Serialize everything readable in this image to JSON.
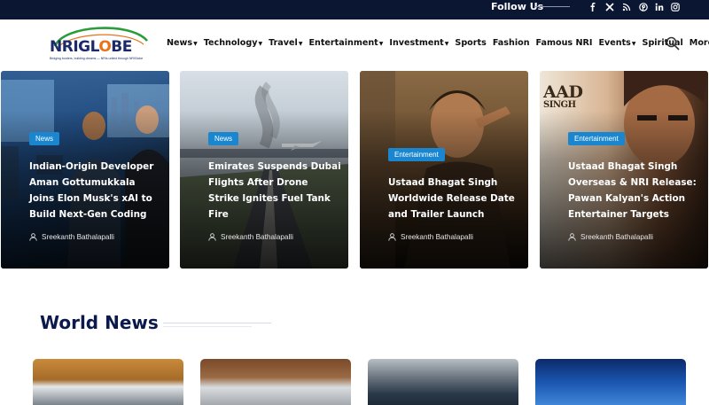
{
  "topbar": {
    "follow_label": "Follow Us",
    "social_icons": [
      "facebook-icon",
      "x-icon",
      "rss-icon",
      "pinterest-icon",
      "linkedin-icon",
      "instagram-icon"
    ]
  },
  "brand": {
    "name_part1": "NRI",
    "name_part2": "GL",
    "name_o": "O",
    "name_part3": "BE",
    "tagline": "Bridging borders, building dreams — NRIs united through NRIGlobe",
    "accent": "#e8731a",
    "primary": "#1b2a6b"
  },
  "nav": {
    "items": [
      {
        "label": "News",
        "dropdown": true
      },
      {
        "label": "Technology",
        "dropdown": true
      },
      {
        "label": "Travel",
        "dropdown": true
      },
      {
        "label": "Entertainment",
        "dropdown": true
      },
      {
        "label": "Investment",
        "dropdown": true
      },
      {
        "label": "Sports",
        "dropdown": false
      },
      {
        "label": "Fashion",
        "dropdown": false
      },
      {
        "label": "Famous NRI",
        "dropdown": false
      },
      {
        "label": "Events",
        "dropdown": true
      },
      {
        "label": "Spiritual",
        "dropdown": false
      },
      {
        "label": "More",
        "dropdown": true
      }
    ],
    "search_icon": "search-icon"
  },
  "featured": [
    {
      "category": "News",
      "title": "Indian-Origin Developer Aman Gottumukkala Joins Elon Musk's xAI to Build Next-Gen Coding",
      "author": "Sreekanth Bathalapalli"
    },
    {
      "category": "News",
      "title": "Emirates Suspends Dubai Flights After Drone Strike Ignites Fuel Tank Fire",
      "author": "Sreekanth Bathalapalli"
    },
    {
      "category": "Entertainment",
      "title": "Ustaad Bhagat Singh Worldwide Release Date and Trailer Launch",
      "author": "Sreekanth Bathalapalli"
    },
    {
      "category": "Entertainment",
      "title": "Ustaad Bhagat Singh Overseas & NRI Release: Pawan Kalyan's Action Entertainer Targets",
      "author": "Sreekanth Bathalapalli"
    }
  ],
  "poster_text": "AAD\nSINGH",
  "section": {
    "title": "World News"
  },
  "colors": {
    "topbar_bg": "#0b1633",
    "badge": "#1a86d0",
    "section_title": "#0b1a4a"
  }
}
